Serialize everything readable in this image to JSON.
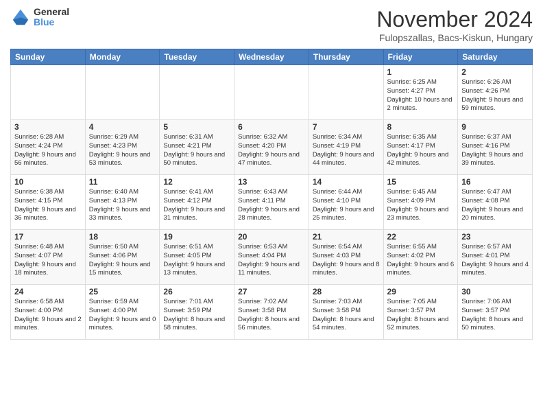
{
  "logo": {
    "general": "General",
    "blue": "Blue"
  },
  "title": "November 2024",
  "location": "Fulopszallas, Bacs-Kiskun, Hungary",
  "headers": [
    "Sunday",
    "Monday",
    "Tuesday",
    "Wednesday",
    "Thursday",
    "Friday",
    "Saturday"
  ],
  "weeks": [
    [
      {
        "day": "",
        "info": ""
      },
      {
        "day": "",
        "info": ""
      },
      {
        "day": "",
        "info": ""
      },
      {
        "day": "",
        "info": ""
      },
      {
        "day": "",
        "info": ""
      },
      {
        "day": "1",
        "info": "Sunrise: 6:25 AM\nSunset: 4:27 PM\nDaylight: 10 hours\nand 2 minutes."
      },
      {
        "day": "2",
        "info": "Sunrise: 6:26 AM\nSunset: 4:26 PM\nDaylight: 9 hours\nand 59 minutes."
      }
    ],
    [
      {
        "day": "3",
        "info": "Sunrise: 6:28 AM\nSunset: 4:24 PM\nDaylight: 9 hours\nand 56 minutes."
      },
      {
        "day": "4",
        "info": "Sunrise: 6:29 AM\nSunset: 4:23 PM\nDaylight: 9 hours\nand 53 minutes."
      },
      {
        "day": "5",
        "info": "Sunrise: 6:31 AM\nSunset: 4:21 PM\nDaylight: 9 hours\nand 50 minutes."
      },
      {
        "day": "6",
        "info": "Sunrise: 6:32 AM\nSunset: 4:20 PM\nDaylight: 9 hours\nand 47 minutes."
      },
      {
        "day": "7",
        "info": "Sunrise: 6:34 AM\nSunset: 4:19 PM\nDaylight: 9 hours\nand 44 minutes."
      },
      {
        "day": "8",
        "info": "Sunrise: 6:35 AM\nSunset: 4:17 PM\nDaylight: 9 hours\nand 42 minutes."
      },
      {
        "day": "9",
        "info": "Sunrise: 6:37 AM\nSunset: 4:16 PM\nDaylight: 9 hours\nand 39 minutes."
      }
    ],
    [
      {
        "day": "10",
        "info": "Sunrise: 6:38 AM\nSunset: 4:15 PM\nDaylight: 9 hours\nand 36 minutes."
      },
      {
        "day": "11",
        "info": "Sunrise: 6:40 AM\nSunset: 4:13 PM\nDaylight: 9 hours\nand 33 minutes."
      },
      {
        "day": "12",
        "info": "Sunrise: 6:41 AM\nSunset: 4:12 PM\nDaylight: 9 hours\nand 31 minutes."
      },
      {
        "day": "13",
        "info": "Sunrise: 6:43 AM\nSunset: 4:11 PM\nDaylight: 9 hours\nand 28 minutes."
      },
      {
        "day": "14",
        "info": "Sunrise: 6:44 AM\nSunset: 4:10 PM\nDaylight: 9 hours\nand 25 minutes."
      },
      {
        "day": "15",
        "info": "Sunrise: 6:45 AM\nSunset: 4:09 PM\nDaylight: 9 hours\nand 23 minutes."
      },
      {
        "day": "16",
        "info": "Sunrise: 6:47 AM\nSunset: 4:08 PM\nDaylight: 9 hours\nand 20 minutes."
      }
    ],
    [
      {
        "day": "17",
        "info": "Sunrise: 6:48 AM\nSunset: 4:07 PM\nDaylight: 9 hours\nand 18 minutes."
      },
      {
        "day": "18",
        "info": "Sunrise: 6:50 AM\nSunset: 4:06 PM\nDaylight: 9 hours\nand 15 minutes."
      },
      {
        "day": "19",
        "info": "Sunrise: 6:51 AM\nSunset: 4:05 PM\nDaylight: 9 hours\nand 13 minutes."
      },
      {
        "day": "20",
        "info": "Sunrise: 6:53 AM\nSunset: 4:04 PM\nDaylight: 9 hours\nand 11 minutes."
      },
      {
        "day": "21",
        "info": "Sunrise: 6:54 AM\nSunset: 4:03 PM\nDaylight: 9 hours\nand 8 minutes."
      },
      {
        "day": "22",
        "info": "Sunrise: 6:55 AM\nSunset: 4:02 PM\nDaylight: 9 hours\nand 6 minutes."
      },
      {
        "day": "23",
        "info": "Sunrise: 6:57 AM\nSunset: 4:01 PM\nDaylight: 9 hours\nand 4 minutes."
      }
    ],
    [
      {
        "day": "24",
        "info": "Sunrise: 6:58 AM\nSunset: 4:00 PM\nDaylight: 9 hours\nand 2 minutes."
      },
      {
        "day": "25",
        "info": "Sunrise: 6:59 AM\nSunset: 4:00 PM\nDaylight: 9 hours\nand 0 minutes."
      },
      {
        "day": "26",
        "info": "Sunrise: 7:01 AM\nSunset: 3:59 PM\nDaylight: 8 hours\nand 58 minutes."
      },
      {
        "day": "27",
        "info": "Sunrise: 7:02 AM\nSunset: 3:58 PM\nDaylight: 8 hours\nand 56 minutes."
      },
      {
        "day": "28",
        "info": "Sunrise: 7:03 AM\nSunset: 3:58 PM\nDaylight: 8 hours\nand 54 minutes."
      },
      {
        "day": "29",
        "info": "Sunrise: 7:05 AM\nSunset: 3:57 PM\nDaylight: 8 hours\nand 52 minutes."
      },
      {
        "day": "30",
        "info": "Sunrise: 7:06 AM\nSunset: 3:57 PM\nDaylight: 8 hours\nand 50 minutes."
      }
    ]
  ]
}
